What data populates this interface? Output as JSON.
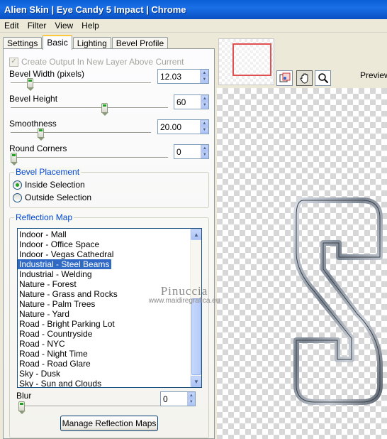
{
  "window": {
    "title": "Alien Skin | Eye Candy 5 Impact | Chrome"
  },
  "menu": [
    "Edit",
    "Filter",
    "View",
    "Help"
  ],
  "tabs": [
    "Settings",
    "Basic",
    "Lighting",
    "Bevel Profile"
  ],
  "basic": {
    "create_output_label": "Create Output In New Layer Above Current",
    "bevel_width": {
      "label": "Bevel Width (pixels)",
      "value": "12.03",
      "slider_fraction": 0.12
    },
    "bevel_height": {
      "label": "Bevel Height",
      "value": "60",
      "slider_fraction": 0.6
    },
    "smoothness": {
      "label": "Smoothness",
      "value": "20.00",
      "slider_fraction": 0.2
    },
    "round_corners": {
      "label": "Round Corners",
      "value": "0",
      "slider_fraction": 0.0
    },
    "placement": {
      "title": "Bevel Placement",
      "inside": "Inside Selection",
      "outside": "Outside Selection",
      "selected": "inside"
    },
    "reflection": {
      "title": "Reflection Map",
      "items": [
        "Indoor - Mall",
        "Indoor - Office Space",
        "Indoor - Vegas Cathedral",
        "Industrial - Steel Beams",
        "Industrial - Welding",
        "Nature - Forest",
        "Nature - Grass and Rocks",
        "Nature - Palm Trees",
        "Nature - Yard",
        "Road - Bright Parking Lot",
        "Road - Countryside",
        "Road - NYC",
        "Road - Night Time",
        "Road - Road Glare",
        "Sky - Dusk",
        "Sky - Sun and Clouds"
      ],
      "selected_index": 3,
      "blur_label": "Blur",
      "blur_value": "0",
      "blur_fraction": 0.0,
      "manage_button": "Manage Reflection Maps"
    }
  },
  "preview": {
    "label": "Preview"
  },
  "watermark": {
    "line1": "Pinuccia",
    "line2": "www.maidiregrafica.eu"
  },
  "icons": {
    "tool_1": "preview-navigator-icon",
    "tool_2": "hand-icon",
    "tool_3": "zoom-icon"
  }
}
